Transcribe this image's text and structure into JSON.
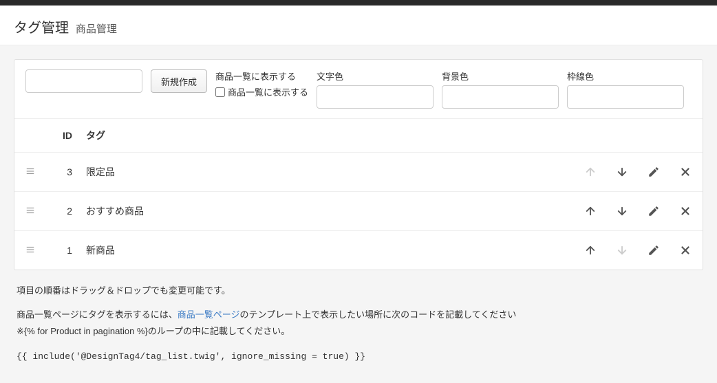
{
  "header": {
    "title": "タグ管理",
    "subtitle": "商品管理"
  },
  "filters": {
    "create_label": "新規作成",
    "show_in_list": {
      "label": "商品一覧に表示する",
      "checkbox_label": "商品一覧に表示する"
    },
    "text_color_label": "文字色",
    "bg_color_label": "背景色",
    "border_color_label": "枠線色"
  },
  "table": {
    "head": {
      "id": "ID",
      "tag": "タグ"
    },
    "rows": [
      {
        "id": "3",
        "tag": "限定品",
        "up_disabled": true,
        "down_disabled": false
      },
      {
        "id": "2",
        "tag": "おすすめ商品",
        "up_disabled": false,
        "down_disabled": false
      },
      {
        "id": "1",
        "tag": "新商品",
        "up_disabled": false,
        "down_disabled": true
      }
    ]
  },
  "footer": {
    "line1": "項目の順番はドラッグ＆ドロップでも変更可能です。",
    "line2_pre": "商品一覧ページにタグを表示するには、",
    "line2_link": "商品一覧ページ",
    "line2_post": "のテンプレート上で表示したい場所に次のコードを記載してください",
    "line3": "※{% for Product in pagination %}のループの中に記載してください。",
    "code": "{{ include('@DesignTag4/tag_list.twig', ignore_missing = true) }}"
  }
}
